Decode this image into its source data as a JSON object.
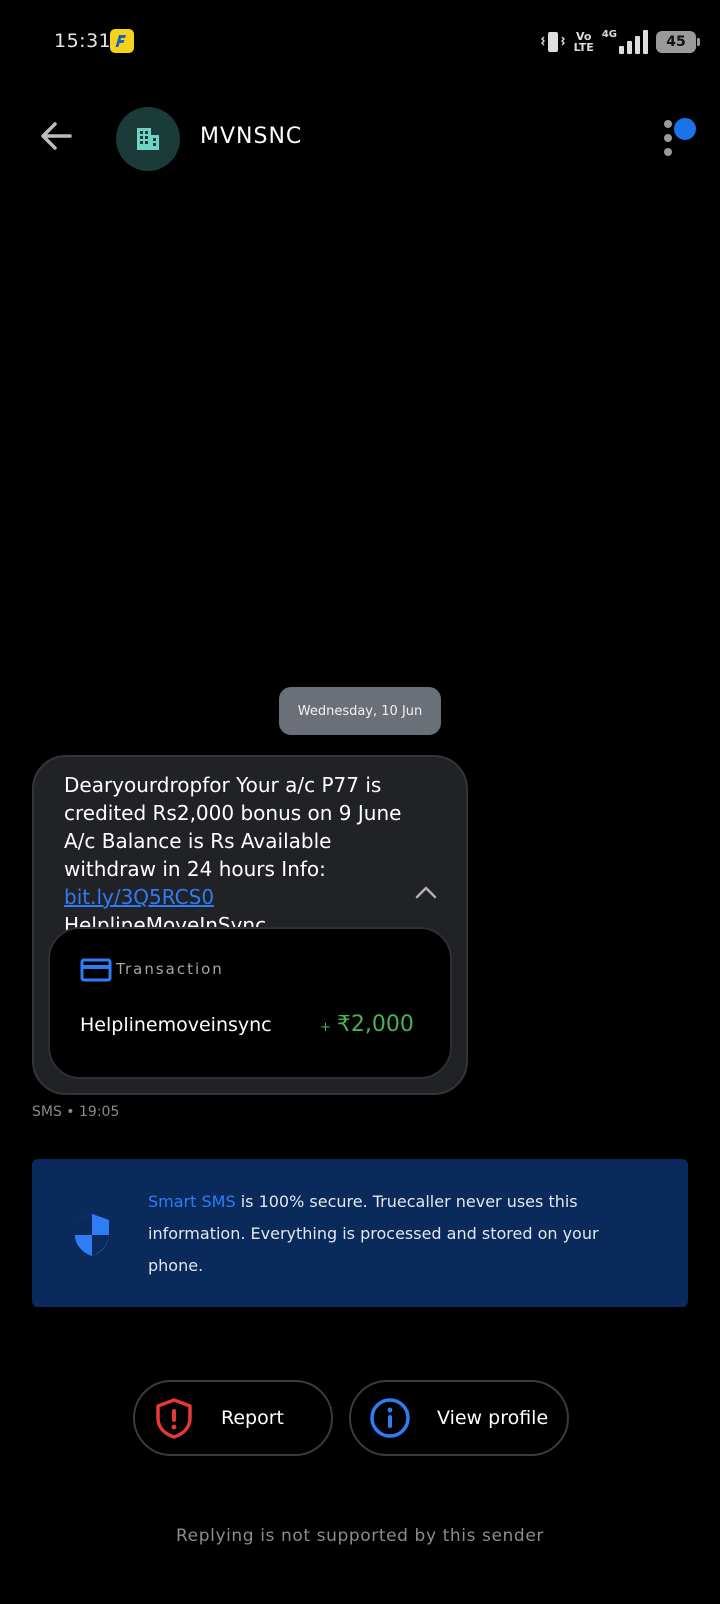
{
  "status_bar": {
    "time": "15:31",
    "volte_top": "Vo",
    "volte_bottom": "LTE",
    "network": "4G",
    "battery": "45"
  },
  "header": {
    "sender": "MVNSNC"
  },
  "conversation": {
    "date_chip": "Wednesday, 10 Jun",
    "message": {
      "text_before_link": "Dearyourdropfor Your a/c P77 is credited Rs2,000 bonus on 9 June A/c Balance is Rs Available withdraw in 24 hours Info: ",
      "link": "bit.ly/3Q5RCS0",
      "text_after_link": " HelplineMoveInSync"
    },
    "transaction": {
      "label": "Transaction",
      "payee": "Helplinemoveinsync",
      "sign": "+",
      "amount": "₹2,000"
    },
    "meta": "SMS • 19:05"
  },
  "secure_banner": {
    "highlight": "Smart SMS",
    "text": " is 100% secure. Truecaller never uses this information. Everything is processed and stored on your phone."
  },
  "actions": {
    "report_label": "Report",
    "view_profile_label": "View profile"
  },
  "footer": "Replying is not supported by this sender",
  "colors": {
    "accent_blue": "#2f7cf6",
    "amount_green": "#46b255",
    "report_red": "#e53935",
    "banner_bg": "#0a2a5c"
  }
}
